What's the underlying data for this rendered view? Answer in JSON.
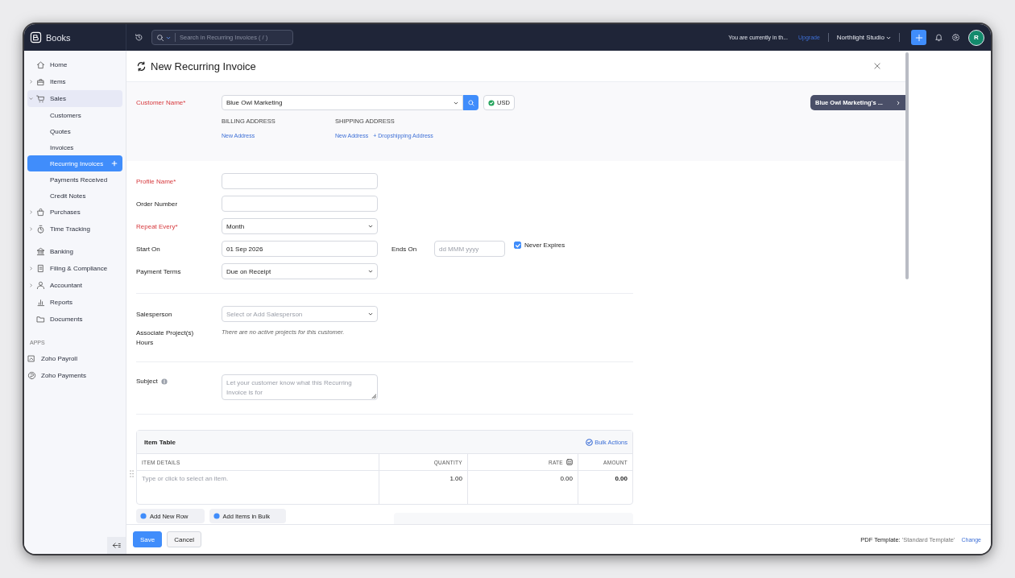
{
  "app": {
    "name": "Books"
  },
  "topbar": {
    "search": {
      "placeholder": "Search in Recurring Invoices ( / )"
    },
    "trial_notice": "You are currently in th...",
    "upgrade_link": "Upgrade",
    "organization": "Northlight Studio",
    "avatar": "R"
  },
  "sidebar": {
    "groups": [
      {
        "items": [
          {
            "label": "Home",
            "kind": "link",
            "selected": false
          },
          {
            "label": "Items",
            "kind": "group",
            "expanded": false,
            "selected": false
          },
          {
            "label": "Sales",
            "kind": "group",
            "expanded": true,
            "selected": true,
            "children": [
              {
                "label": "Customers",
                "selected": false
              },
              {
                "label": "Quotes",
                "selected": false
              },
              {
                "label": "Invoices",
                "selected": false
              },
              {
                "label": "Recurring Invoices",
                "selected": true
              },
              {
                "label": "Payments Received",
                "selected": false
              },
              {
                "label": "Credit Notes",
                "selected": false
              }
            ]
          },
          {
            "label": "Purchases",
            "kind": "group",
            "expanded": false,
            "selected": false
          },
          {
            "label": "Time Tracking",
            "kind": "group",
            "expanded": false,
            "selected": false
          }
        ]
      },
      {
        "items": [
          {
            "label": "Banking",
            "kind": "link",
            "selected": false
          },
          {
            "label": "Filing & Compliance",
            "kind": "group",
            "expanded": false,
            "selected": false
          },
          {
            "label": "Accountant",
            "kind": "group",
            "expanded": false,
            "selected": false
          },
          {
            "label": "Reports",
            "kind": "link",
            "selected": false
          },
          {
            "label": "Documents",
            "kind": "link",
            "selected": false
          }
        ]
      }
    ],
    "apps": {
      "title": "APPS",
      "items": [
        {
          "label": "Zoho Payroll"
        },
        {
          "label": "Zoho Payments"
        }
      ]
    }
  },
  "page": {
    "title": "New Recurring Invoice"
  },
  "customer": {
    "label": "Customer Name*",
    "required": true,
    "value": "Blue Owl Marketing",
    "currency": "USD",
    "billing": {
      "title": "BILLING ADDRESS",
      "links": [
        "New Address"
      ]
    },
    "shipping": {
      "title": "SHIPPING ADDRESS",
      "links": [
        "New Address",
        "+ Dropshipping Address"
      ]
    },
    "details_button": "Blue Owl Marketing's ..."
  },
  "form_sections": [
    {
      "rows": [
        {
          "label": "Profile Name*",
          "required": true,
          "kind": "text"
        },
        {
          "label": "Order Number",
          "required": false,
          "kind": "text"
        },
        {
          "label": "Repeat Every*",
          "required": true,
          "kind": "select",
          "value": "Month"
        },
        {
          "label": "Start On",
          "required": false,
          "kind": "date",
          "value": "01 Sep 2026",
          "end": {
            "label": "Ends On",
            "placeholder": "dd MMM yyyy",
            "never_expires": {
              "label": "Never Expires",
              "checked": true
            }
          }
        },
        {
          "label": "Payment Terms",
          "required": false,
          "kind": "select",
          "value": "Due on Receipt"
        }
      ]
    },
    {
      "rows": [
        {
          "label": "Salesperson",
          "required": false,
          "kind": "select",
          "placeholder": "Select or Add Salesperson"
        },
        {
          "label": "Associate Project(s) Hours",
          "required": false,
          "kind": "note",
          "note": "There are no active projects for this customer."
        }
      ]
    },
    {
      "rows": [
        {
          "label": "Subject",
          "required": false,
          "kind": "textarea",
          "info": true,
          "placeholder": "Let your customer know what this Recurring Invoice is for"
        }
      ]
    }
  ],
  "item_table": {
    "title": "Item Table",
    "bulk_actions": "Bulk Actions",
    "columns": [
      "ITEM DETAILS",
      "QUANTITY",
      "RATE",
      "AMOUNT"
    ],
    "rows": [
      {
        "item_placeholder": "Type or click to select an item.",
        "quantity": "1.00",
        "rate": "0.00",
        "amount": "0.00"
      }
    ]
  },
  "add_buttons": [
    "Add New Row",
    "Add Items in Bulk"
  ],
  "footer": {
    "buttons": [
      {
        "label": "Save",
        "kind": "primary"
      },
      {
        "label": "Cancel",
        "kind": "secondary"
      }
    ],
    "pdf_template": {
      "label": "PDF Template:",
      "value": "'Standard Template'",
      "change": "Change"
    }
  }
}
